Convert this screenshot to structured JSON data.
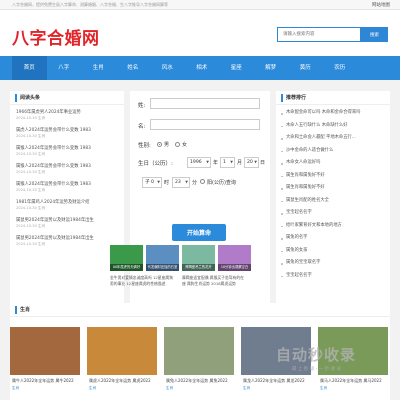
{
  "topbar": {
    "notice": "八字合婚网，提供免费生辰八字算命、测算婚姻、八字合婚、生八字推导八字合婚网算等",
    "home_label": "网站地图"
  },
  "header": {
    "logo": "八字合婚网",
    "search_placeholder": "请输入搜索内容",
    "search_button": "搜索"
  },
  "nav": {
    "items": [
      "首页",
      "八字",
      "生肖",
      "姓名",
      "风水",
      "相术",
      "星座",
      "解梦",
      "黄历",
      "农历"
    ],
    "active_index": 0
  },
  "left_panel": {
    "title": "阅读头条",
    "items": [
      {
        "text": "1966年属虎男人2024年事业运势",
        "date": "2024-10-30",
        "tag": "生肖"
      },
      {
        "text": "属虎人2024年运势会带什么变数 1983",
        "date": "2024-10-30",
        "tag": "生肖"
      },
      {
        "text": "属猴人2024年运势会带什么变数 1983",
        "date": "2024-10-30",
        "tag": "生肖"
      },
      {
        "text": "属猴人2024年运势会带什么变数 1983",
        "date": "2024-10-30",
        "tag": "生肖"
      },
      {
        "text": "属猴人2024年运势会带什么变数 1983",
        "date": "2024-10-30",
        "tag": "生肖"
      },
      {
        "text": "1981年属鸡人2024年运势及财运介绍",
        "date": "2024-10-30",
        "tag": "生肖"
      },
      {
        "text": "属鼠男2024年运势以及财运1984年出生",
        "date": "2024-10-30",
        "tag": "生肖"
      },
      {
        "text": "属鼠男2024年运势以及财运1984年出生",
        "date": "2024-10-30",
        "tag": "生肖"
      }
    ]
  },
  "form": {
    "surname_label": "姓:",
    "name_label": "名:",
    "gender_label": "性别:",
    "male": "男",
    "female": "女",
    "gender_selected": "男",
    "birth_label": "生日（公历）:",
    "year": "1996",
    "year_unit": "年",
    "month": "1",
    "month_unit": "月",
    "day": "20",
    "day_unit": "日",
    "hour": "子 0",
    "hour_unit": "时",
    "minute": "23",
    "minute_unit": "分",
    "calendar_toggle": "阳(公历)查询",
    "submit_label": "开始算命"
  },
  "thumbs": [
    {
      "caption": "00年属虎的天蝎好",
      "color": "#3a9a4a"
    },
    {
      "caption": "代发偏财还摇的石室",
      "color": "#5b8fc1"
    },
    {
      "caption": "摩羯座吊兰的花卉",
      "color": "#7bb9a0"
    },
    {
      "caption": "10分钟出观察空白",
      "color": "#b07cc9"
    }
  ],
  "captions": [
    "金牛男对爱情忠诚度高吗 12星座属狗男的事业 12星座属虎的性格描述",
    "摩羯座适宜配偶 属猴买子坐驾有的在座 属狗生肖运势 2018属虎运势"
  ],
  "captions_right": [
    "12生肖属鼠的人命运分析 00年属虎的运势",
    "12生肖影响的力量 算命是 好 00年属鼠的运势"
  ],
  "right_panel": {
    "title": "推荐排行",
    "items": [
      "木命配金命可以吗 木命和金命合得来吗",
      "木命人五行缺什么 木命缺什么好",
      "大命和土命会人最配 平地木命五行...",
      "沙中金命的人适合做什么",
      "木命女人命运好吗",
      "属生肖和属兔好不好",
      "属生肖和属兔好不好",
      "属鼠生肖配的姓名大全",
      "宝宝起名名字",
      "给叶家繁育好文和本地的地方",
      "属兔的名字",
      "属兔的女孩",
      "属兔的宝宝取名字",
      "宝宝起名名字"
    ]
  },
  "shengxiao": {
    "title": "生肖",
    "cards": [
      {
        "title": "属牛人2022年全年运势 属牛2022",
        "tag": "生肖",
        "color": "#a4683e"
      },
      {
        "title": "属虎人2022年全年运势 属虎2022",
        "tag": "生肖",
        "color": "#c88a3a"
      },
      {
        "title": "属兔人2022年全年运势 属兔2022",
        "tag": "生肖",
        "color": "#8fa07a"
      },
      {
        "title": "属龙人2022年全年运势 属龙2022",
        "tag": "生肖",
        "color": "#6f7d8f"
      },
      {
        "title": "属马人2022年全年运势 属马2022",
        "tag": "生肖",
        "color": "#7a9a5a"
      }
    ]
  },
  "watermark": {
    "title": "自动秒收录",
    "subtitle": "最 上 秒 级 - 一 秒 收 录"
  }
}
